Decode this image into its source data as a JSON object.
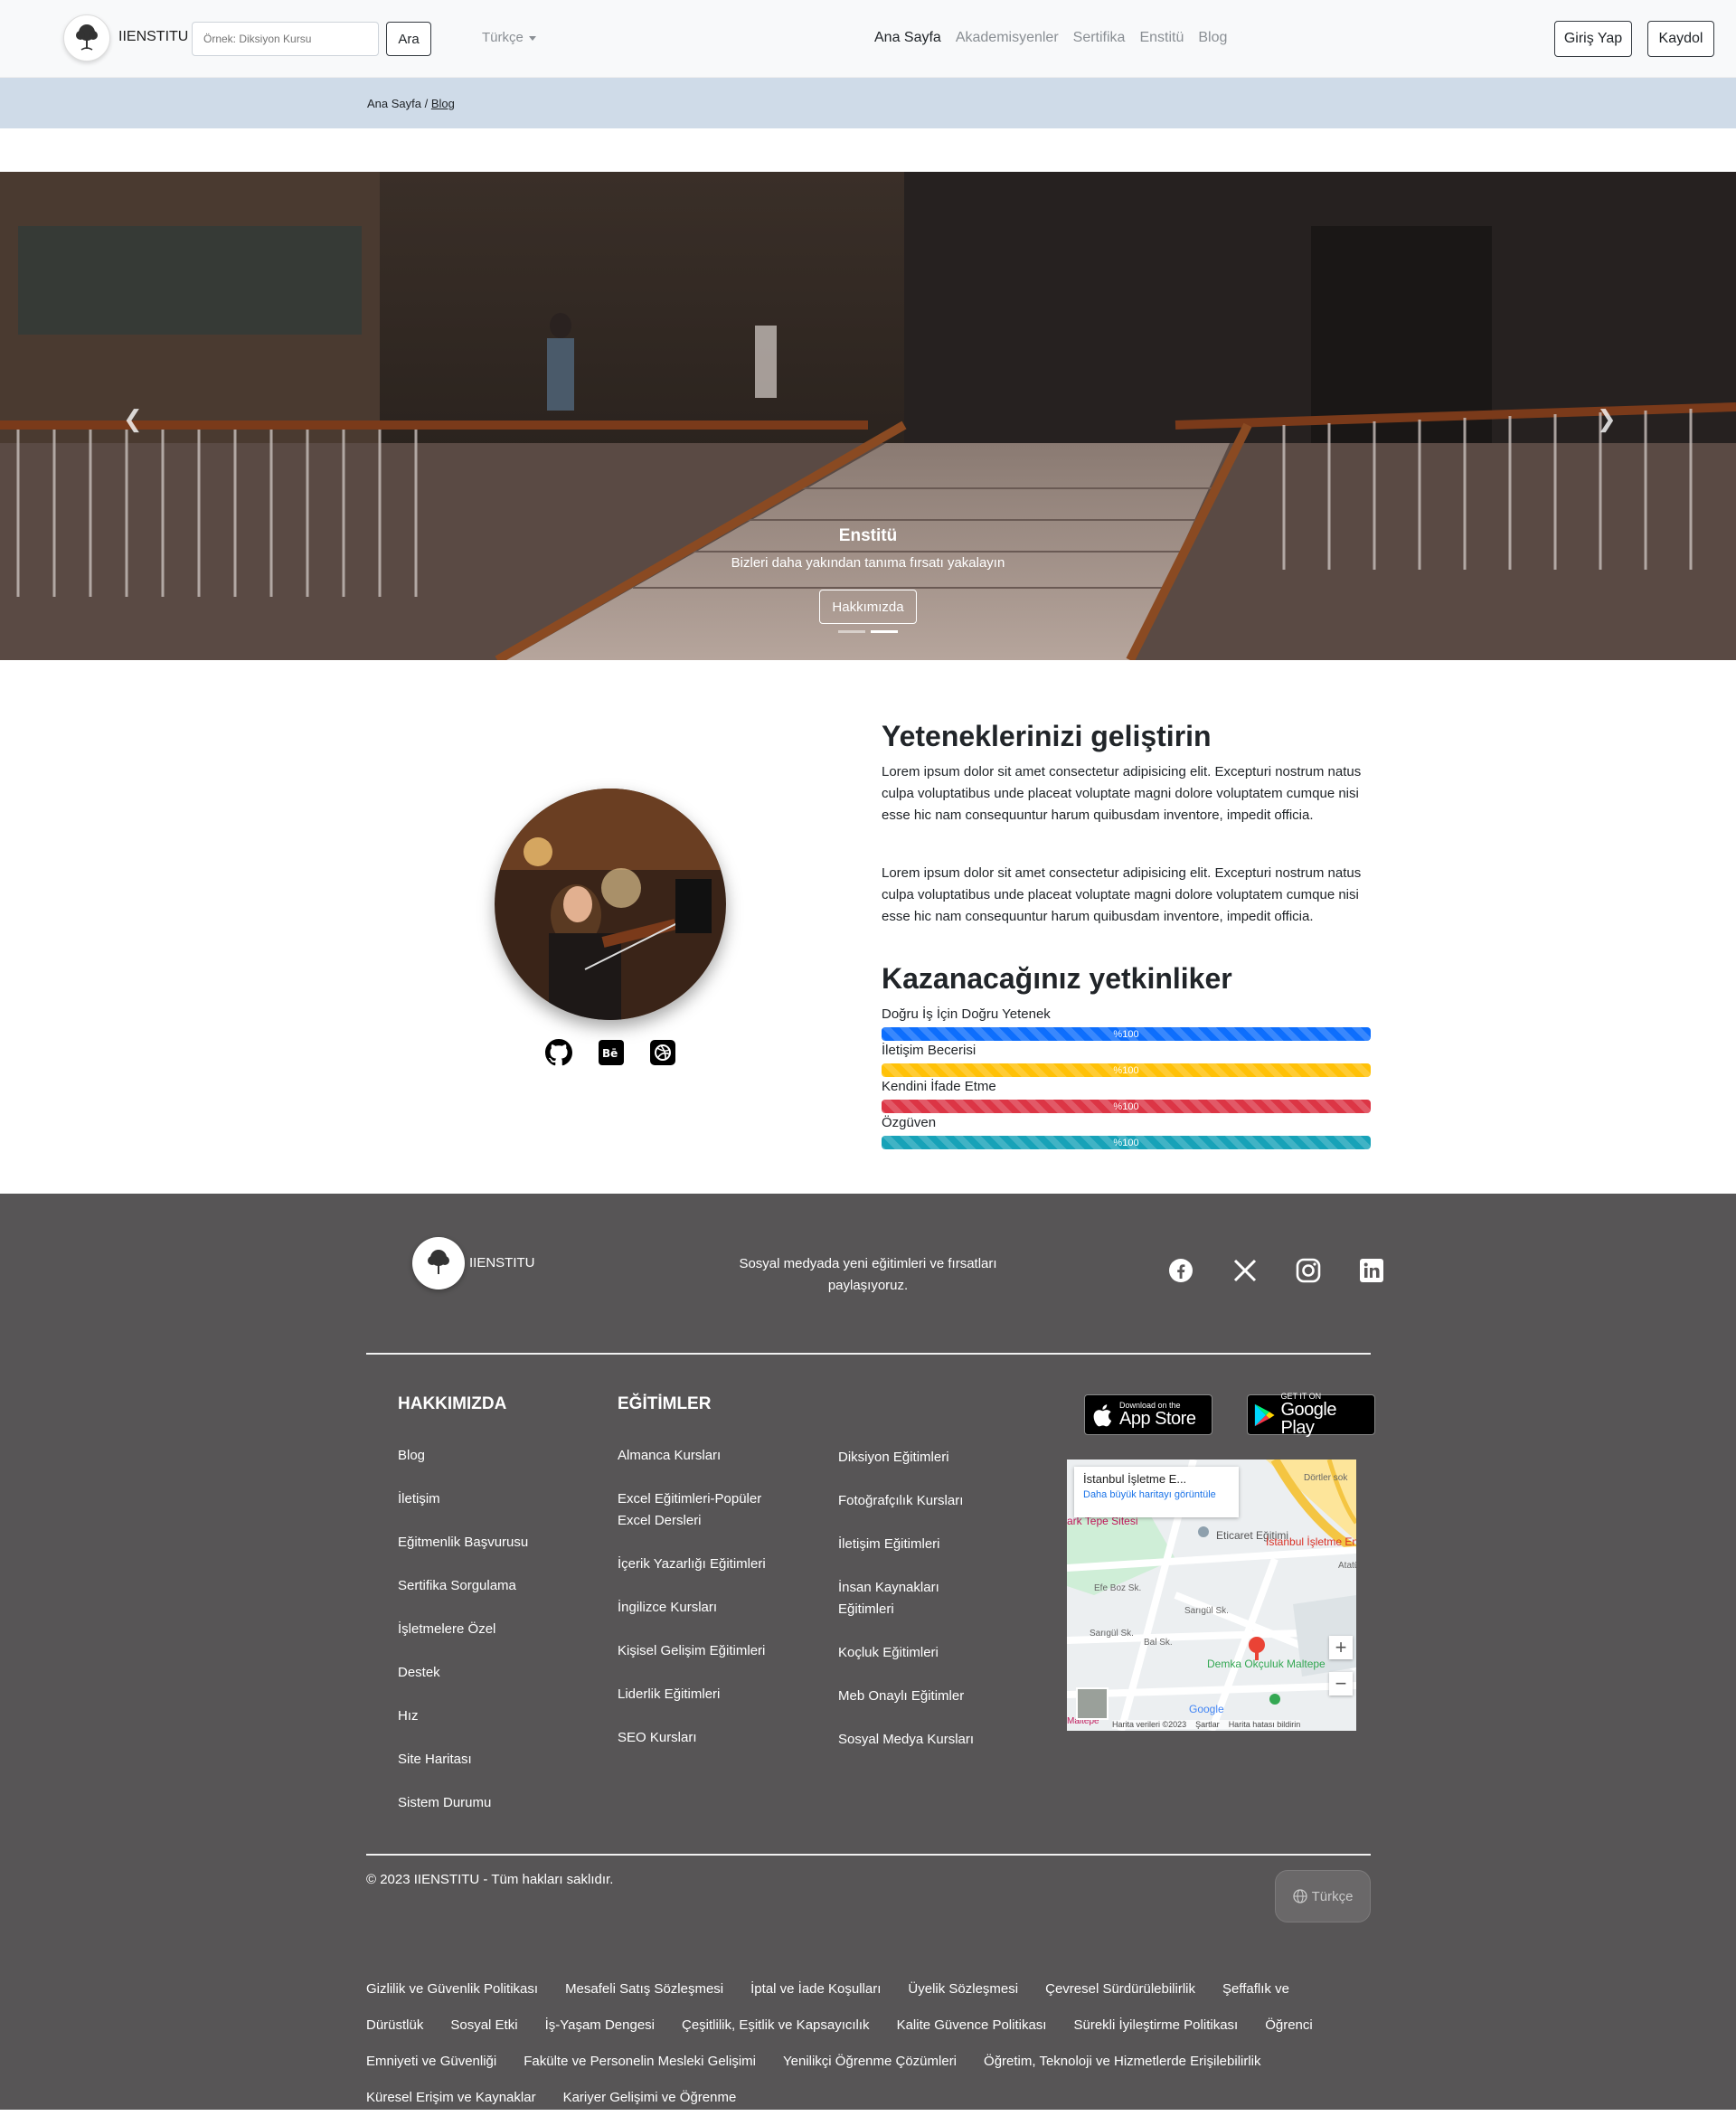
{
  "navbar": {
    "brand": "IIENSTITU",
    "search_placeholder": "Örnek: Diksiyon Kursu",
    "search_button": "Ara",
    "language": "Türkçe",
    "links": [
      "Ana Sayfa",
      "Akademisyenler",
      "Sertifika",
      "Enstitü",
      "Blog"
    ],
    "login": "Giriş Yap",
    "register": "Kaydol"
  },
  "breadcrumb": {
    "home": "Ana Sayfa",
    "separator": "/",
    "current": "Blog"
  },
  "hero": {
    "title": "Enstitü",
    "subtitle": "Bizleri daha yakından tanıma fırsatı yakalayın",
    "button": "Hakkımızda"
  },
  "skills": {
    "heading": "Yeteneklerinizi geliştirin",
    "paragraphs": [
      "Lorem ipsum dolor sit amet consectetur adipisicing elit. Excepturi nostrum natus culpa voluptatibus unde placeat voluptate magni dolore voluptatem cumque nisi esse hic nam consequuntur harum quibusdam inventore, impedit officia.",
      "Lorem ipsum dolor sit amet consectetur adipisicing elit. Excepturi nostrum natus culpa voluptatibus unde placeat voluptate magni dolore voluptatem cumque nisi esse hic nam consequuntur harum quibusdam inventore, impedit officia."
    ],
    "competencies_heading": "Kazanacağınız yetkinliker",
    "bars": [
      {
        "label": "Doğru İş İçin Doğru Yetenek",
        "value": "%100",
        "color": "#0d6efd"
      },
      {
        "label": "İletişim Becerisi",
        "value": "%100",
        "color": "#ffc107"
      },
      {
        "label": "Kendini İfade Etme",
        "value": "%100",
        "color": "#dc3545"
      },
      {
        "label": "Özgüven",
        "value": "%100",
        "color": "#17a2b8"
      }
    ],
    "profile_icons": [
      "github-icon",
      "behance-icon",
      "dribbble-icon"
    ]
  },
  "footer": {
    "brand": "IIENSTITU",
    "tagline": "Sosyal medyada yeni eğitimleri ve fırsatları paylaşıyoruz.",
    "social_icons": [
      "facebook-icon",
      "x-icon",
      "instagram-icon",
      "linkedin-icon"
    ],
    "about_heading": "HAKKIMIZDA",
    "about_links": [
      "Blog",
      "İletişim",
      "Eğitmenlik Başvurusu",
      "Sertifika Sorgulama",
      "İşletmelere Özel",
      "Destek",
      "Hız",
      "Site Haritası",
      "Sistem Durumu"
    ],
    "courses_heading": "EĞİTİMLER",
    "courses_col1": [
      "Almanca Kursları",
      "Excel Eğitimleri-Popüler Excel Dersleri",
      "İçerik Yazarlığı Eğitimleri",
      "İngilizce Kursları",
      "Kişisel Gelişim Eğitimleri",
      "Liderlik Eğitimleri",
      "SEO Kursları"
    ],
    "courses_col2": [
      "Diksiyon Eğitimleri",
      "Fotoğrafçılık Kursları",
      "İletişim Eğitimleri",
      "İnsan Kaynakları Eğitimleri",
      "Koçluk Eğitimleri",
      "Meb Onaylı Eğitimler",
      "Sosyal Medya Kursları"
    ],
    "app_store": {
      "small": "Download on the",
      "large": "App Store"
    },
    "google_play": {
      "small": "GET IT ON",
      "large": "Google Play"
    },
    "map": {
      "place_title": "İstanbul İşletme E...",
      "larger_map": "Daha büyük haritayı görüntüle",
      "labels": [
        "Eticaret Eğitimi",
        "İstanbul İşletme Enstitü",
        "Demka Okçuluk Maltepe",
        "ark Tepe Sitesi",
        "Efe Boz Sk.",
        "Sarıgül Sk.",
        "Sarıgül Sk.",
        "Bal Sk.",
        "Dörtler sok",
        "Atatürk C",
        "Maltepe"
      ],
      "footer_items": [
        "Harita verileri ©2023",
        "Şartlar",
        "Harita hatası bildirin"
      ],
      "google": "Google"
    },
    "copyright": "© 2023 IIENSTITU - Tüm hakları saklıdır.",
    "language": "Türkçe",
    "legal_links": [
      "Gizlilik ve Güvenlik Politikası",
      "Mesafeli Satış Sözleşmesi",
      "İptal ve İade Koşulları",
      "Üyelik Sözleşmesi",
      "Çevresel Sürdürülebilirlik",
      "Şeffaflık ve",
      "Dürüstlük",
      "Sosyal Etki",
      "İş-Yaşam Dengesi",
      "Çeşitlilik, Eşitlik ve Kapsayıcılık",
      "Kalite Güvence Politikası",
      "Sürekli İyileştirme Politikası",
      "Öğrenci",
      "Emniyeti ve Güvenliği",
      "Fakülte ve Personelin Mesleki Gelişimi",
      "Yenilikçi Öğrenme Çözümleri",
      "Öğretim, Teknoloji ve Hizmetlerde Erişilebilirlik",
      "Küresel Erişim ve Kaynaklar",
      "Kariyer Gelişimi ve Öğrenme"
    ]
  }
}
